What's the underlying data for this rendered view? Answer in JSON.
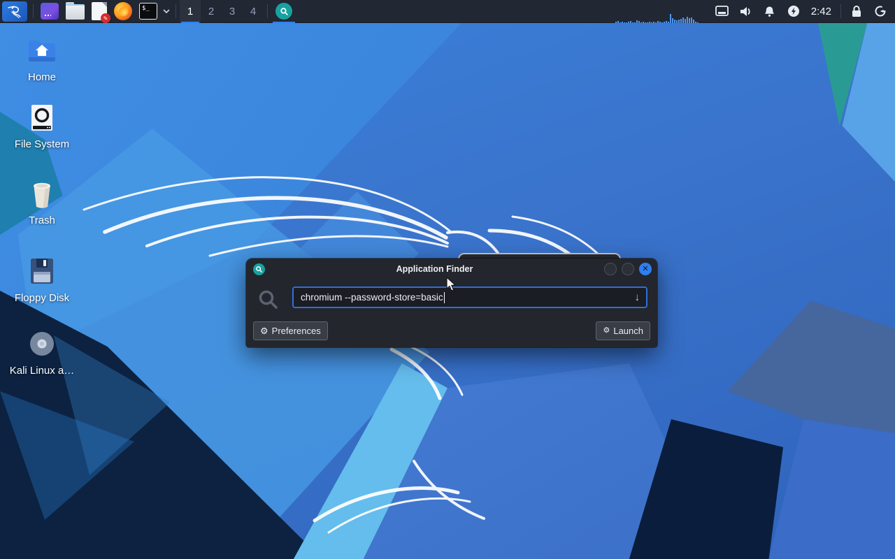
{
  "panel": {
    "launcher": {
      "kali_menu": "kali-menu",
      "terminal_glyph": "$_",
      "icons": [
        "app-window",
        "file-manager",
        "text-editor",
        "firefox",
        "terminal"
      ]
    },
    "workspaces": [
      "1",
      "2",
      "3",
      "4"
    ],
    "active_workspace": "1",
    "taskbar_app": "Application Finder",
    "clock": "2:42",
    "cpu_bars": [
      2,
      3,
      1,
      2,
      1,
      1,
      2,
      3,
      1,
      1,
      4,
      3,
      1,
      2,
      1,
      1,
      2,
      1,
      2,
      1,
      3,
      2,
      1,
      2,
      3,
      2,
      13,
      7,
      5,
      4,
      5,
      6,
      8,
      6,
      9,
      7,
      8,
      5,
      2,
      1
    ]
  },
  "desktop_icons": [
    {
      "label": "Home"
    },
    {
      "label": "File System"
    },
    {
      "label": "Trash"
    },
    {
      "label": "Floppy Disk"
    },
    {
      "label": "Kali Linux a…"
    }
  ],
  "finder": {
    "title": "Application Finder",
    "query": "chromium --password-store=basic",
    "preferences_label": "Preferences",
    "launch_label": "Launch",
    "close_glyph": "✕",
    "gear_glyph": "⚙",
    "dropdown_glyph": "↓"
  },
  "colors": {
    "accent": "#2f6fd8",
    "close_button": "#2f7ff0",
    "panel_bg": "#212733",
    "dialog_bg": "#23262d",
    "finder_teal": "#17a2a0"
  }
}
